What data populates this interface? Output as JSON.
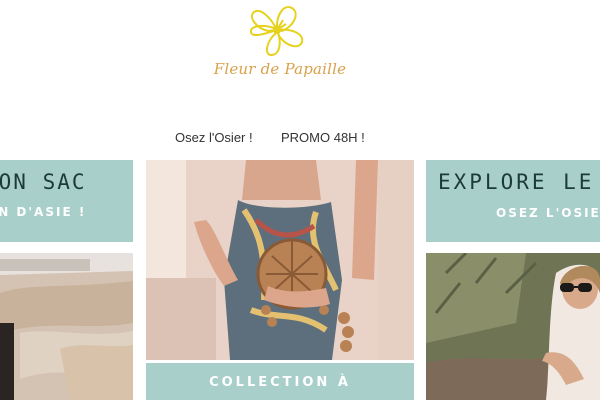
{
  "brand": {
    "name": "Fleur de Papaille",
    "logo_icon": "hibiscus-flower-icon",
    "logo_color": "#d9a24a",
    "flower_color": "#e6d21c"
  },
  "nav": {
    "items": [
      {
        "label": "Osez l'Osier !"
      },
      {
        "label": "PROMO 48H !"
      }
    ]
  },
  "cards": {
    "left": {
      "title": "TON SAC",
      "subtitle": "ON D'ASIE !"
    },
    "center": {
      "button_label": "COLLECTION À"
    },
    "right": {
      "title": "EXPLORE LE",
      "subtitle": "OSEZ L'OSIE"
    }
  },
  "colors": {
    "band": "#a9cfcb",
    "title_text": "#1d3a3a",
    "sub_text": "#ffffff"
  }
}
